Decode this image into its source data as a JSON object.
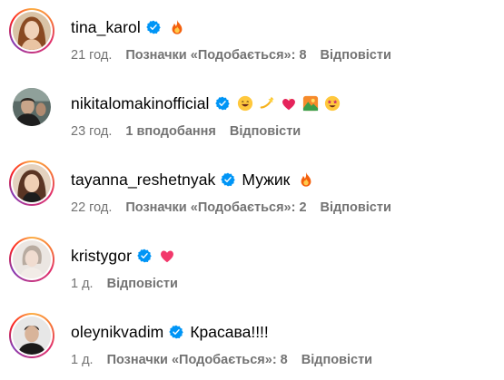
{
  "comments": [
    {
      "username": "tina_karol",
      "text": "",
      "emojis": [
        "fire-emoji"
      ],
      "time": "21 год.",
      "likes": "Позначки «Подобається»: 8",
      "reply": "Відповісти"
    },
    {
      "username": "nikitalomakinofficial",
      "text": "",
      "emojis": [
        "grinning-face-emoji",
        "dizzy-emoji",
        "heart-on-fire-emoji",
        "sunrise-over-mountains-emoji",
        "star-struck-emoji"
      ],
      "time": "23 год.",
      "likes": "1 вподобання",
      "reply": "Відповісти"
    },
    {
      "username": "tayanna_reshetnyak",
      "text": "Мужик",
      "emojis": [
        "fire-emoji"
      ],
      "time": "22 год.",
      "likes": "Позначки «Подобається»: 2",
      "reply": "Відповісти"
    },
    {
      "username": "kristygor",
      "text": "",
      "emojis": [
        "pink-heart-emoji"
      ],
      "time": "1 д.",
      "likes": "",
      "reply": "Відповісти"
    },
    {
      "username": "oleynikvadim",
      "text": "Красава!!!!",
      "emojis": [],
      "time": "1 д.",
      "likes": "Позначки «Подобається»: 8",
      "reply": "Відповісти"
    }
  ],
  "colors": {
    "verified": "#0095f6",
    "meta_text": "#737373",
    "story_ring": "#e1306c"
  }
}
